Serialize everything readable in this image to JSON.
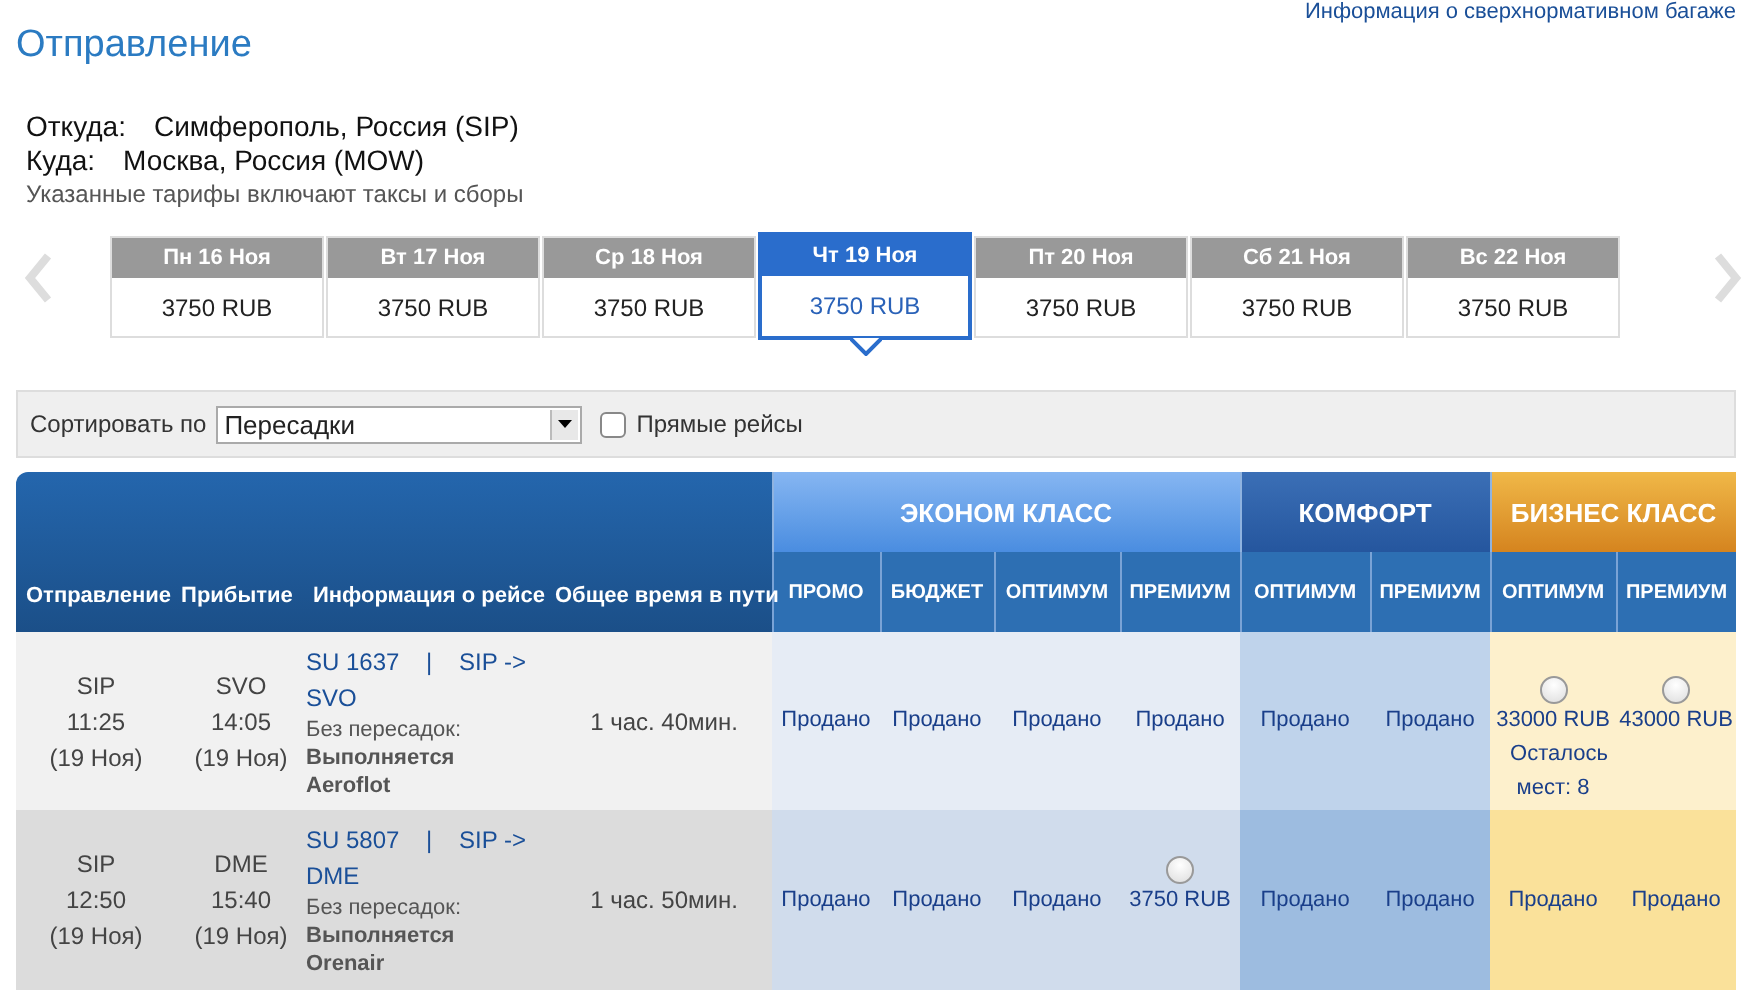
{
  "baggage_link": "Информация о сверхнормативном багаже",
  "title": "Отправление",
  "route": {
    "from_label": "Откуда:",
    "from": "Симферополь, Россия (SIP)",
    "to_label": "Куда:",
    "to": "Москва, Россия (MOW)",
    "note": "Указанные тарифы включают таксы и сборы"
  },
  "dates": [
    {
      "day": "Пн 16 Ноя",
      "price": "3750 RUB",
      "selected": false
    },
    {
      "day": "Вт 17 Ноя",
      "price": "3750 RUB",
      "selected": false
    },
    {
      "day": "Ср 18 Ноя",
      "price": "3750 RUB",
      "selected": false
    },
    {
      "day": "Чт 19 Ноя",
      "price": "3750 RUB",
      "selected": true
    },
    {
      "day": "Пт 20 Ноя",
      "price": "3750 RUB",
      "selected": false
    },
    {
      "day": "Сб 21 Ноя",
      "price": "3750 RUB",
      "selected": false
    },
    {
      "day": "Вс 22 Ноя",
      "price": "3750 RUB",
      "selected": false
    }
  ],
  "sort": {
    "label": "Сортировать по",
    "value": "Пересадки",
    "direct_label": "Прямые рейсы",
    "direct_checked": false
  },
  "columns": [
    "Отправление",
    "Прибытие",
    "Информация о рейсе",
    "Общее время в пути"
  ],
  "fare_groups": [
    {
      "name": "ЭКОНОМ КЛАСС",
      "kind": "economy",
      "subcolumns": [
        "ПРОМО",
        "БЮДЖЕТ",
        "ОПТИМУМ",
        "ПРЕМИУМ"
      ]
    },
    {
      "name": "КОМФОРТ",
      "kind": "comfort",
      "subcolumns": [
        "ОПТИМУМ",
        "ПРЕМИУМ"
      ]
    },
    {
      "name": "БИЗНЕС КЛАСС",
      "kind": "business",
      "subcolumns": [
        "ОПТИМУМ",
        "ПРЕМИУМ"
      ]
    }
  ],
  "flights": [
    {
      "departure": {
        "code": "SIP",
        "time": "11:25",
        "date": "(19 Ноя)"
      },
      "arrival": {
        "code": "SVO",
        "time": "14:05",
        "date": "(19 Ноя)"
      },
      "flight": "SU 1637    |    SIP -> SVO",
      "stops": "Без пересадок:",
      "operator": "Выполняется Aeroflot",
      "duration": "1 час. 40мин.",
      "fares": [
        {
          "kind": "sold",
          "text": "Продано"
        },
        {
          "kind": "sold",
          "text": "Продано"
        },
        {
          "kind": "sold",
          "text": "Продано"
        },
        {
          "kind": "sold",
          "text": "Продано"
        },
        {
          "kind": "sold",
          "text": "Продано"
        },
        {
          "kind": "sold",
          "text": "Продано"
        },
        {
          "kind": "price",
          "text": "33000 RUB",
          "selected": false,
          "note": "Осталось мест: 8"
        },
        {
          "kind": "price",
          "text": "43000 RUB",
          "selected": false
        }
      ]
    },
    {
      "departure": {
        "code": "SIP",
        "time": "12:50",
        "date": "(19 Ноя)"
      },
      "arrival": {
        "code": "DME",
        "time": "15:40",
        "date": "(19 Ноя)"
      },
      "flight": "SU 5807    |    SIP -> DME",
      "stops": "Без пересадок:",
      "operator": "Выполняется Orenair",
      "duration": "1 час. 50мин.",
      "fares": [
        {
          "kind": "sold",
          "text": "Продано"
        },
        {
          "kind": "sold",
          "text": "Продано"
        },
        {
          "kind": "sold",
          "text": "Продано"
        },
        {
          "kind": "price",
          "text": "3750 RUB",
          "selected": false
        },
        {
          "kind": "sold",
          "text": "Продано"
        },
        {
          "kind": "sold",
          "text": "Продано"
        },
        {
          "kind": "sold",
          "text": "Продано"
        },
        {
          "kind": "sold",
          "text": "Продано"
        }
      ]
    }
  ]
}
